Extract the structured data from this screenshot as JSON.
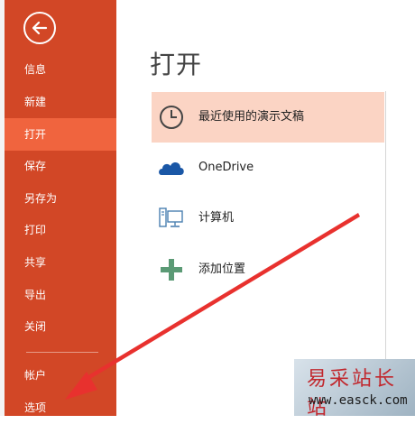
{
  "sidebar": {
    "back_icon": "arrow-left-circle-icon",
    "items": [
      {
        "label": "信息"
      },
      {
        "label": "新建"
      },
      {
        "label": "打开",
        "active": true
      },
      {
        "label": "保存"
      },
      {
        "label": "另存为"
      },
      {
        "label": "打印"
      },
      {
        "label": "共享"
      },
      {
        "label": "导出"
      },
      {
        "label": "关闭"
      },
      {
        "label": "帐户"
      },
      {
        "label": "选项"
      }
    ]
  },
  "main": {
    "title": "打开",
    "places": [
      {
        "label": "最近使用的演示文稿",
        "icon": "clock-icon",
        "selected": true
      },
      {
        "label": "OneDrive",
        "icon": "cloud-icon"
      },
      {
        "label": "计算机",
        "icon": "computer-icon"
      },
      {
        "label": "添加位置",
        "icon": "plus-icon"
      }
    ]
  },
  "watermark": {
    "title": "易采站长站",
    "url": "www.easck.com"
  },
  "colors": {
    "sidebar": "#d24726",
    "sidebar_active": "#f0643e",
    "selected_place": "#fbd4c4",
    "annotation_arrow": "#e8312e",
    "onedrive_blue": "#1a57a6",
    "plus_green": "#5b9a75"
  }
}
